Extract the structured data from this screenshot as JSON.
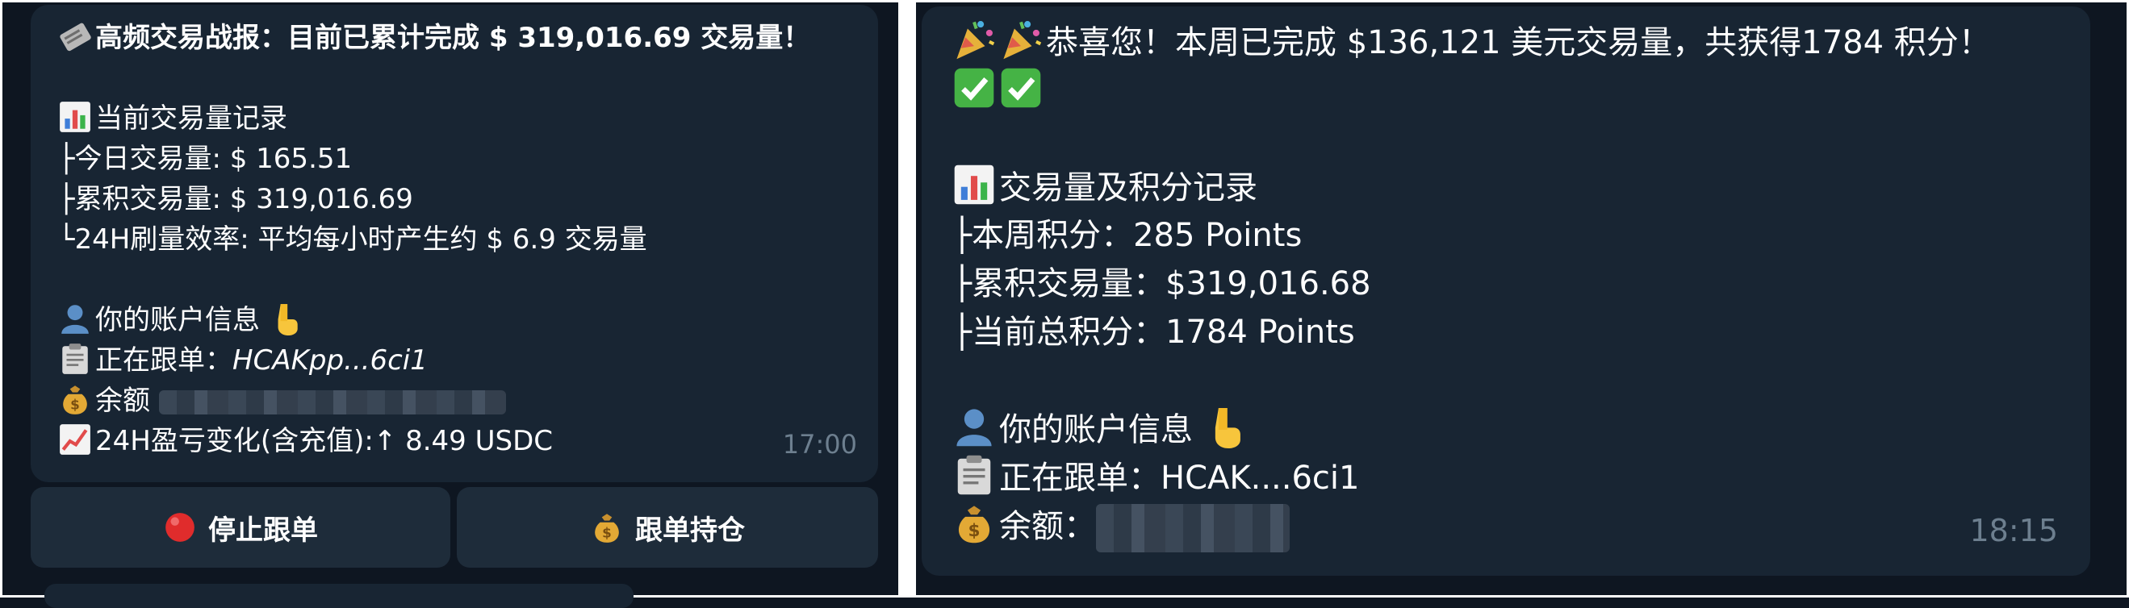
{
  "left_message": {
    "title": "高频交易战报：目前已累计完成 $ 319,016.69 交易量！",
    "section_volume": "当前交易量记录",
    "today_volume": "├今日交易量: $ 165.51",
    "cumulative_volume": "├累积交易量: $ 319,016.69",
    "efficiency": "└24H刷量效率: 平均每小时产生约 $ 6.9 交易量",
    "account_info": "你的账户信息",
    "following_label": "正在跟单：",
    "following_value": "HCAKpp...6ci1",
    "balance_label": "余额",
    "pnl": "24H盈亏变化(含充值):↑ 8.49 USDC",
    "time": "17:00"
  },
  "buttons": {
    "stop_label": "停止跟单",
    "hold_label": "跟单持仓"
  },
  "right_message": {
    "congrats": "恭喜您！本周已完成 $136,121 美元交易量，共获得1784 积分！",
    "section_points": "交易量及积分记录",
    "weekly_points": "├本周积分：285 Points",
    "cumulative_volume": "├累积交易量：$319,016.68",
    "total_points": "├当前总积分：1784 Points",
    "account_info": "你的账户信息",
    "following": "正在跟单：HCAK....6ci1",
    "balance_label": "余额：",
    "time": "18:15"
  },
  "colors": {
    "background": "#0e1621",
    "bubble": "#182533",
    "button": "#1e2c3a",
    "timestamp": "#6d7f8f"
  },
  "icons": [
    "newspaper-icon",
    "chart-icon",
    "user-icon",
    "point-down-icon",
    "clipboard-icon",
    "money-bag-icon",
    "trend-up-icon",
    "red-circle-icon",
    "party-popper-icon",
    "check-mark-icon"
  ]
}
